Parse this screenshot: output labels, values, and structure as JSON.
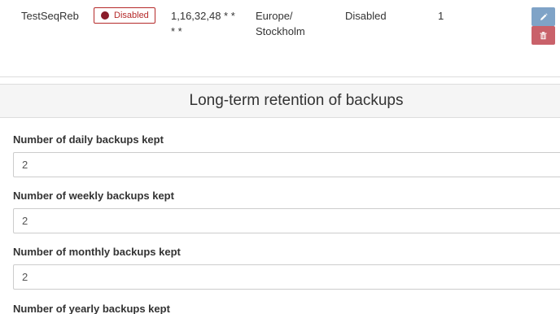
{
  "schedule_row": {
    "name": "TestSeqReb",
    "status_badge": "Disabled",
    "cron_line1": "1,16,32,48 * *",
    "cron_line2": "* *",
    "timezone_line1": "Europe/",
    "timezone_line2": "Stockholm",
    "state": "Disabled",
    "count": "1",
    "edit_icon": "pencil-icon",
    "delete_icon": "trash-icon"
  },
  "retention": {
    "title": "Long-term retention of backups",
    "fields": [
      {
        "label": "Number of daily backups kept",
        "value": "2"
      },
      {
        "label": "Number of weekly backups kept",
        "value": "2"
      },
      {
        "label": "Number of monthly backups kept",
        "value": "2"
      },
      {
        "label": "Number of yearly backups kept",
        "value": ""
      }
    ]
  },
  "colors": {
    "badge_border": "#b52a2a",
    "badge_dot": "#8a1c2a",
    "edit_button": "#7fa3c7",
    "delete_button": "#c9616a",
    "section_header_bg": "#f5f5f5"
  }
}
